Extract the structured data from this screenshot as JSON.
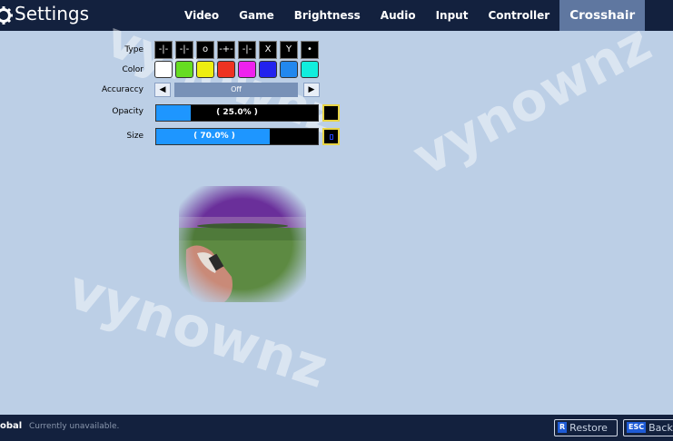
{
  "header": {
    "title": "Settings",
    "tabs": [
      "Video",
      "Game",
      "Brightness",
      "Audio",
      "Input",
      "Controller",
      "Crosshair"
    ],
    "active_tab": "Crosshair"
  },
  "watermark": "vynownz",
  "crosshair": {
    "type_label": "Type",
    "types": [
      "-|-",
      "-|-",
      "o",
      "-+-",
      "-|-",
      "X",
      "Y",
      "•"
    ],
    "color_label": "Color",
    "colors": [
      "#ffffff",
      "#66dd22",
      "#eeee11",
      "#ee3322",
      "#ee22ee",
      "#2222ee",
      "#2288ee",
      "#11eedd"
    ],
    "accuracy_label": "Accuraccy",
    "accuracy_value": "Off",
    "opacity_label": "Opacity",
    "opacity_value": 0.25,
    "opacity_text": "( 25.0% )",
    "size_label": "Size",
    "size_value": 0.7,
    "size_text": "( 70.0% )"
  },
  "footer": {
    "global_label": "obal",
    "status": "Currently unavailable.",
    "restore_key": "R",
    "restore_label": "Restore",
    "back_key": "ESC",
    "back_label": "Back"
  }
}
